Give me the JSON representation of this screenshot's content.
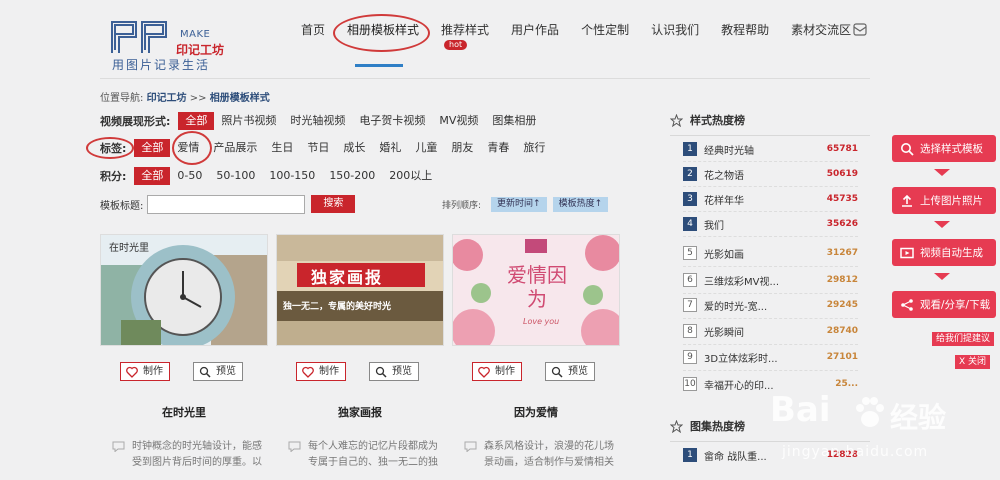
{
  "logo": {
    "make": "MAKE",
    "brand": "印记工坊",
    "slogan": "用图片记录生活"
  },
  "nav": {
    "items": [
      {
        "label": "首页"
      },
      {
        "label": "相册模板样式"
      },
      {
        "label": "推荐样式",
        "badge": "hot"
      },
      {
        "label": "用户作品"
      },
      {
        "label": "个性定制"
      },
      {
        "label": "认识我们"
      },
      {
        "label": "教程帮助"
      },
      {
        "label": "素材交流区"
      }
    ],
    "mail_icon": "mail-icon"
  },
  "breadcrumb": {
    "prefix": "位置导航:",
    "home": "印记工坊",
    "sep": ">>",
    "current": "相册模板样式"
  },
  "filters": {
    "type": {
      "label": "视频展现形式:",
      "options": [
        "全部",
        "照片书视频",
        "时光轴视频",
        "电子贺卡视频",
        "MV视频",
        "图集相册"
      ]
    },
    "tag": {
      "label": "标签:",
      "options": [
        "全部",
        "爱情",
        "产品展示",
        "生日",
        "节日",
        "成长",
        "婚礼",
        "儿童",
        "朋友",
        "青春",
        "旅行"
      ]
    },
    "points": {
      "label": "积分:",
      "options": [
        "全部",
        "0-50",
        "50-100",
        "100-150",
        "150-200",
        "200以上"
      ]
    }
  },
  "search": {
    "label": "模板标题:",
    "value": "",
    "button": "搜索"
  },
  "sort": {
    "label": "排列顺序:",
    "by_time": "更新时间↑",
    "by_heat": "模板热度↑"
  },
  "cards": [
    {
      "thumb_text": "在时光里",
      "make": "制作",
      "preview": "预览",
      "title": "在时光里",
      "desc": "时钟概念的时光轴设计，能感受到图片背后时间的厚重。以"
    },
    {
      "thumb_text": "独家画报",
      "thumb_sub": "独一无二，专属的美好时光",
      "make": "制作",
      "preview": "预览",
      "title": "独家画报",
      "desc": "每个人难忘的记忆片段都成为专属于自己的、独一无二的独"
    },
    {
      "thumb_text": "爱情因为",
      "thumb_sub": "Love you",
      "make": "制作",
      "preview": "预览",
      "title": "因为爱情",
      "desc": "森系风格设计，浪漫的花儿场景动画，适合制作与爱情相关"
    }
  ],
  "rank_style": {
    "title": "样式热度榜",
    "items": [
      {
        "rank": "1",
        "name": "经典时光轴",
        "value": "65781"
      },
      {
        "rank": "2",
        "name": "花之物语",
        "value": "50619"
      },
      {
        "rank": "3",
        "name": "花样年华",
        "value": "45735"
      },
      {
        "rank": "4",
        "name": "我们",
        "value": "35626"
      },
      {
        "rank": "5",
        "name": "光影如画",
        "value": "31267"
      },
      {
        "rank": "6",
        "name": "三维炫彩MV视...",
        "value": "29812"
      },
      {
        "rank": "7",
        "name": "爱的时光-宽...",
        "value": "29245"
      },
      {
        "rank": "8",
        "name": "光影瞬间",
        "value": "28740"
      },
      {
        "rank": "9",
        "name": "3D立体炫彩时...",
        "value": "27101"
      },
      {
        "rank": "10",
        "name": "幸福开心的印...",
        "value": "25..."
      }
    ]
  },
  "rank_album": {
    "title": "图集热度榜",
    "items": [
      {
        "rank": "1",
        "name": "畲命 战队重...",
        "value": "12828"
      }
    ]
  },
  "float": {
    "buttons": [
      "选择样式模板",
      "上传图片照片",
      "视频自动生成",
      "观看/分享/下载"
    ],
    "suggest": "给我们提建议",
    "close": "X 关闭"
  },
  "watermark": {
    "brand": "Bai",
    "brand2": "经验",
    "url": "jingyan.baidu.com"
  },
  "colors": {
    "accent": "#c9252c",
    "navy": "#2d4d7a",
    "float": "#e63b52",
    "nav_underline": "#2f7fc6"
  }
}
